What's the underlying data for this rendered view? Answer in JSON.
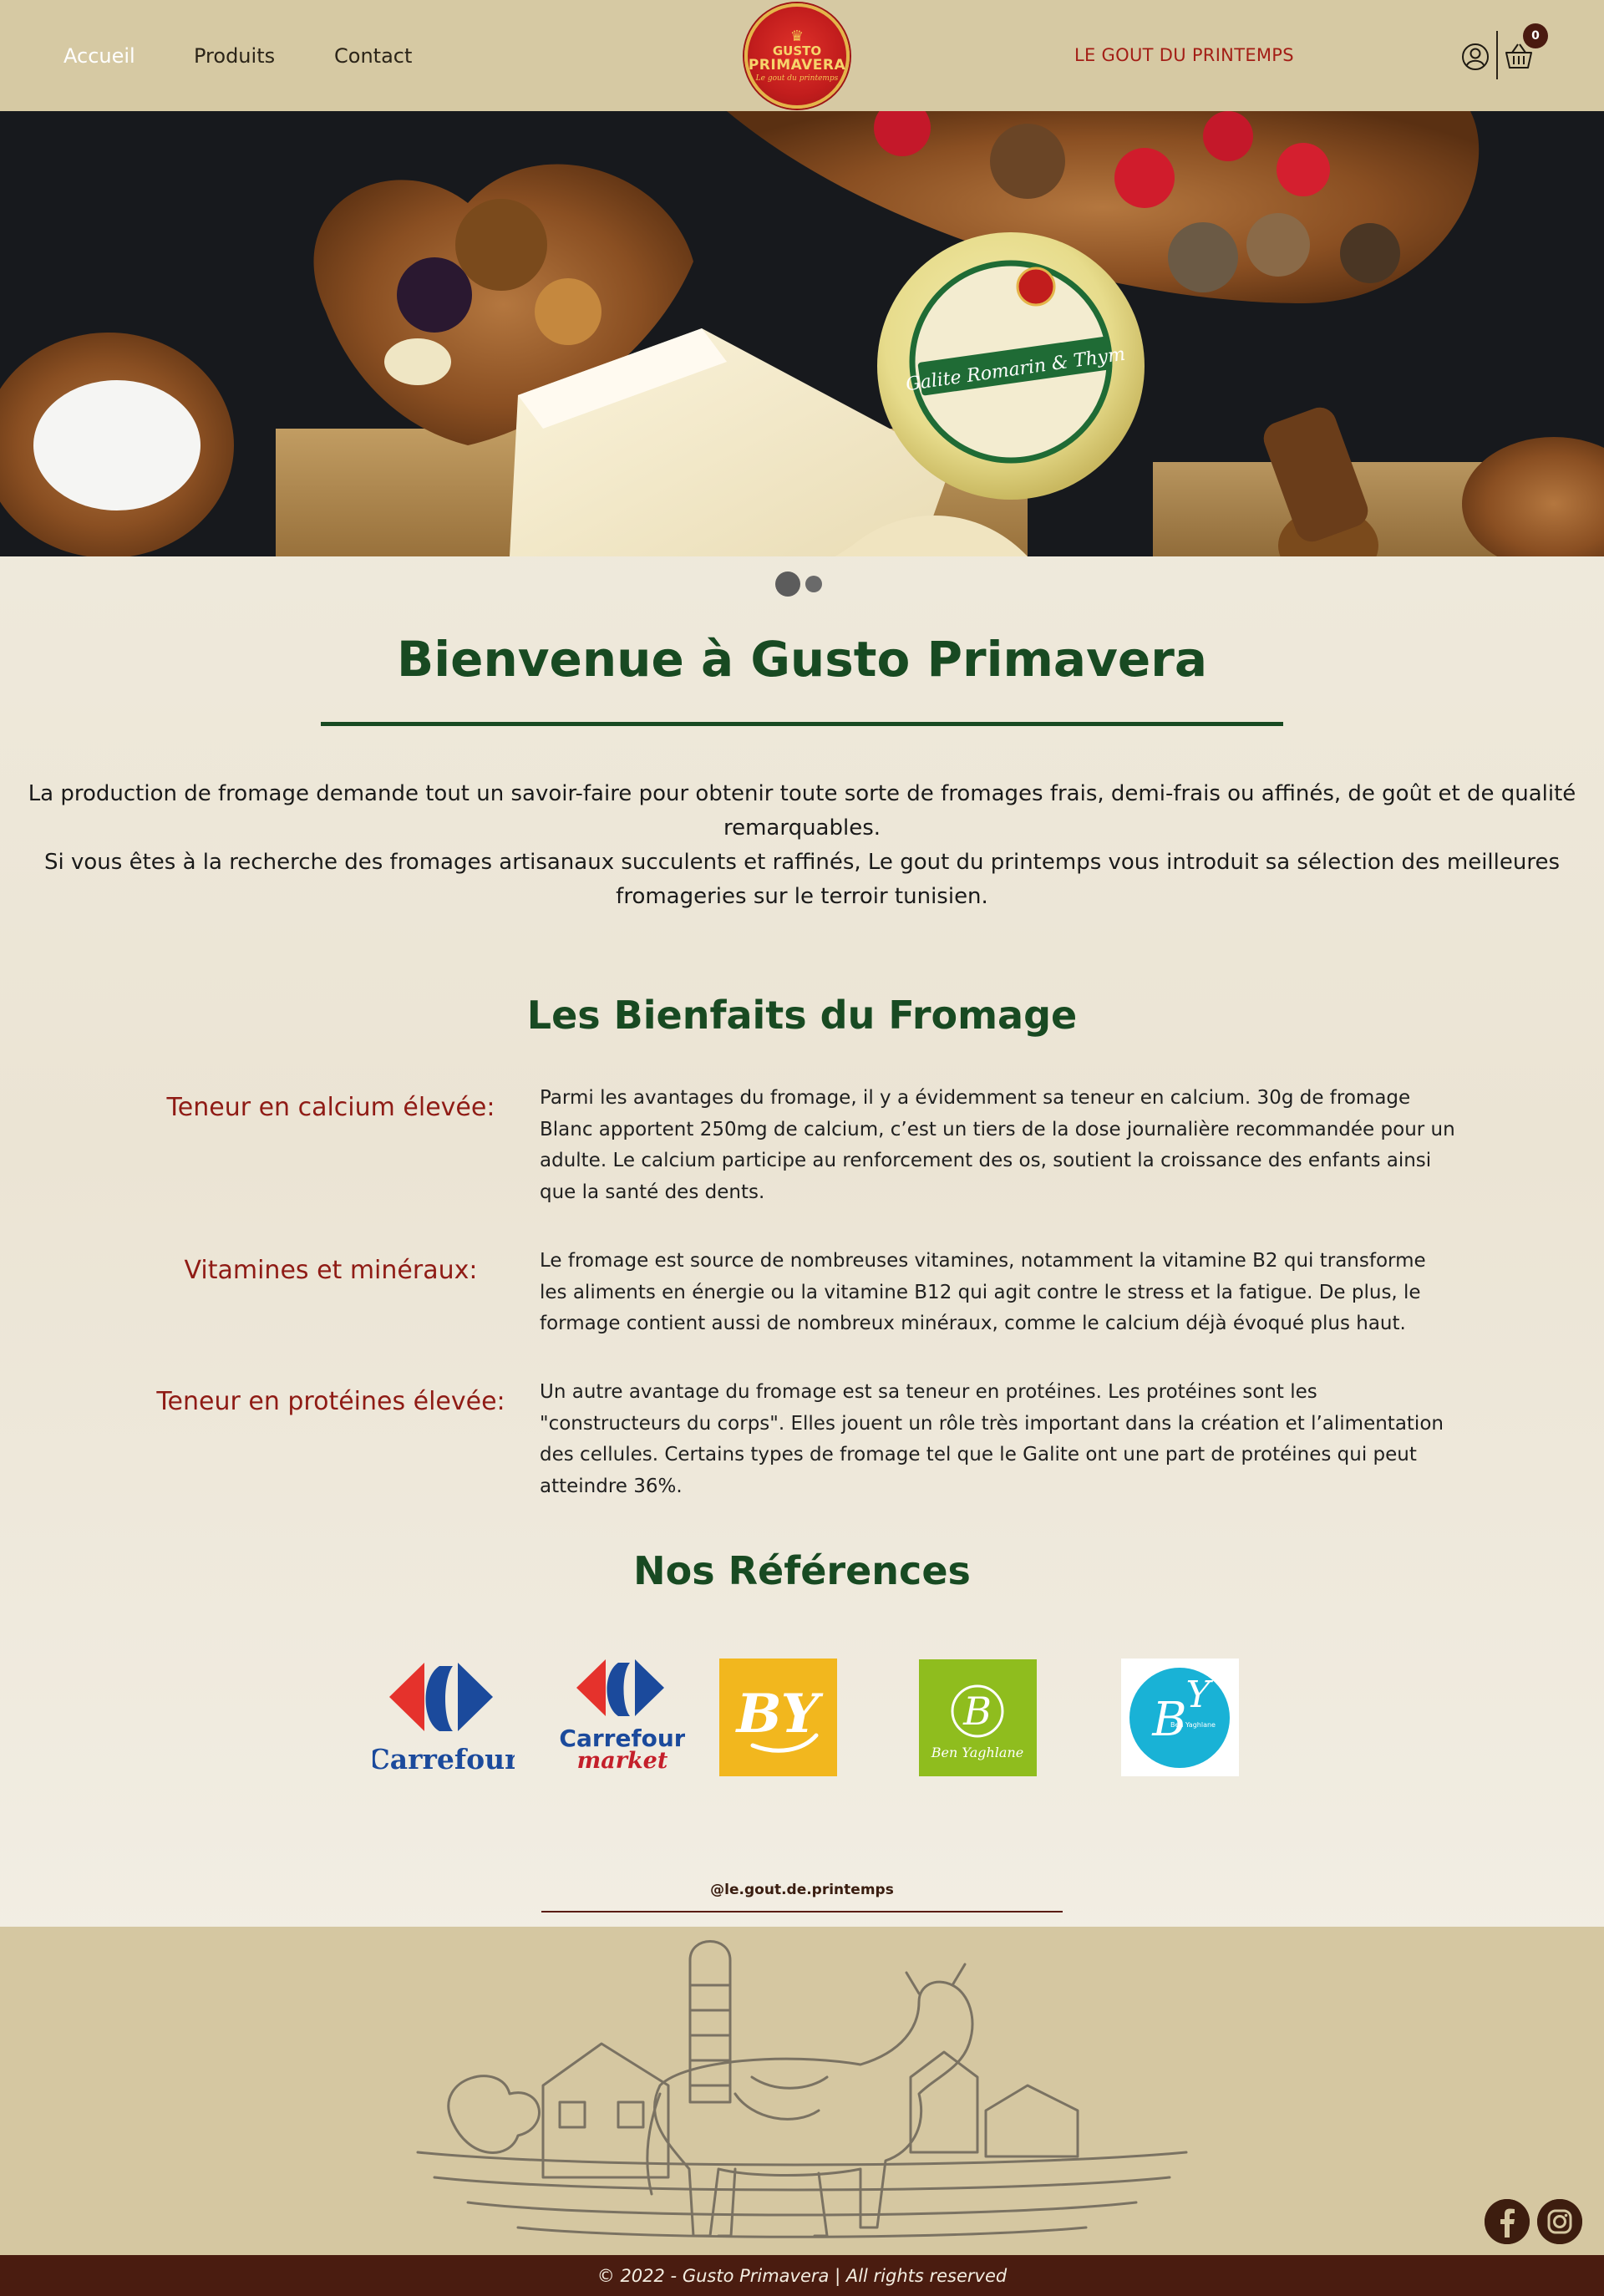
{
  "nav": {
    "items": [
      {
        "label": "Accueil",
        "active": true
      },
      {
        "label": "Produits",
        "active": false
      },
      {
        "label": "Contact",
        "active": false
      }
    ],
    "tagline": "LE GOUT DU PRINTEMPS",
    "cart_count": "0",
    "icons": [
      "user-icon",
      "basket-icon"
    ]
  },
  "logo": {
    "line1": "GUSTO",
    "line2": "PRIMAVERA",
    "line3": "Le gout du printemps"
  },
  "hero": {
    "label_text": "Galite Romarin & Thym",
    "slides_count": 2,
    "active_slide": 1
  },
  "welcome": {
    "title": "Bienvenue à Gusto Primavera",
    "paragraph1": "La production de fromage demande tout un savoir-faire pour obtenir toute sorte de fromages frais, demi-frais ou affinés, de goût et de qualité remarquables.",
    "paragraph2": "Si vous êtes à la recherche des fromages artisanaux succulents et raffinés, Le gout du printemps vous introduit sa sélection des meilleures fromageries sur le terroir tunisien."
  },
  "benefits": {
    "title": "Les Bienfaits du Fromage",
    "items": [
      {
        "label": "Teneur en calcium élevée:",
        "text": "Parmi les avantages du fromage, il y a évidemment sa teneur en calcium. 30g de fromage Blanc apportent 250mg de calcium, c’est un tiers de la dose journalière recommandée pour un adulte. Le calcium participe au renforcement des os, soutient la croissance des enfants ainsi que la santé des dents."
      },
      {
        "label": "Vitamines et minéraux:",
        "text": "Le fromage est source de nombreuses vitamines, notamment la vitamine B2 qui transforme les aliments en énergie ou la vitamine B12 qui agit contre le stress et la fatigue. De plus, le formage contient aussi de nombreux minéraux, comme le calcium déjà évoqué plus haut."
      },
      {
        "label": "Teneur en protéines élevée:",
        "text": "Un autre avantage du fromage est sa teneur en protéines. Les protéines sont les \"constructeurs du corps\". Elles jouent un rôle très important dans la création et l’alimentation des cellules. Certains types de fromage tel que le Galite ont une part de protéines qui peut atteindre 36%."
      }
    ]
  },
  "references": {
    "title": "Nos Références",
    "logos": [
      {
        "name": "Carrefour",
        "text": "Carrefour"
      },
      {
        "name": "Carrefour market",
        "text1": "Carrefour",
        "text2": "market"
      },
      {
        "name": "BY",
        "text": "BY"
      },
      {
        "name": "Ben Yaghlane green",
        "text": "Ben Yaghlane"
      },
      {
        "name": "Ben Yaghlane blue",
        "text": "Ben Yaghlane"
      }
    ]
  },
  "instagram_handle": "@le.gout.de.printemps",
  "footer": {
    "copyright": "© 2022 - Gusto Primavera | All rights reserved",
    "social_icons": [
      "facebook-icon",
      "instagram-icon"
    ]
  },
  "colors": {
    "header_bg": "#d6c9a3",
    "title_green": "#184a22",
    "label_red": "#8f1b15",
    "footer_brown": "#4a1c10"
  }
}
